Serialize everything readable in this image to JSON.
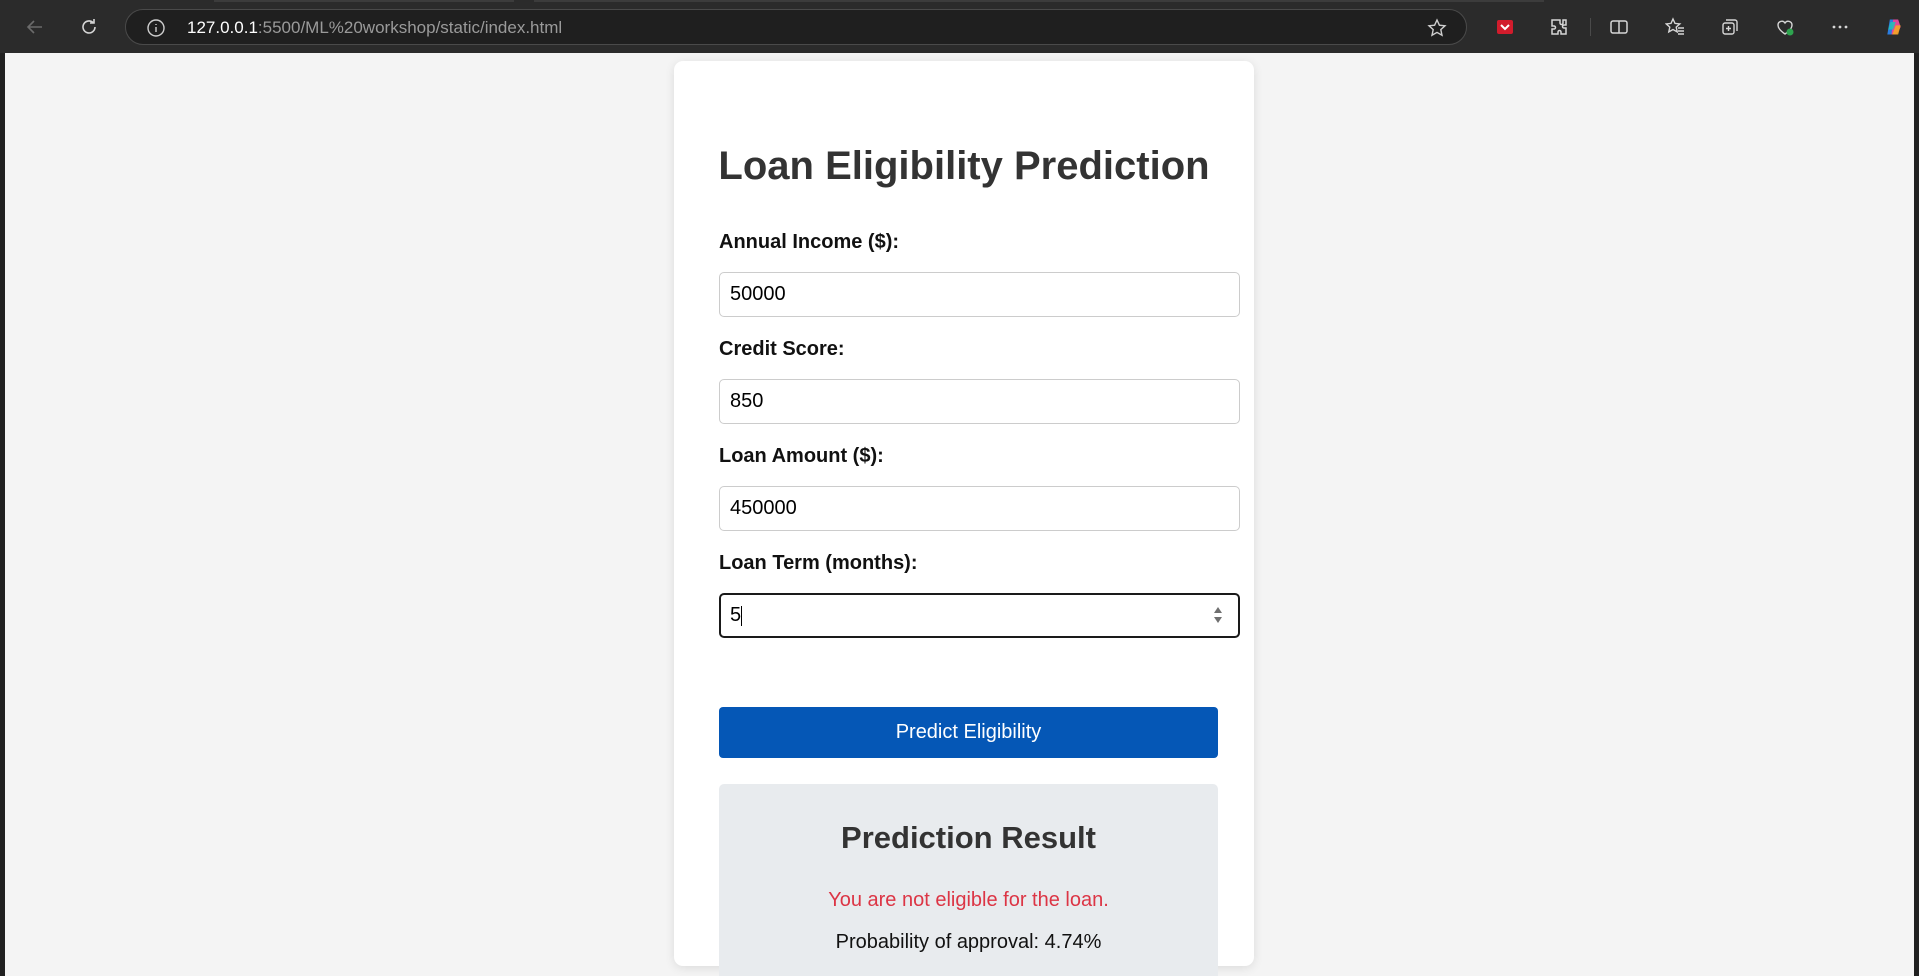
{
  "browser": {
    "url_host": "127.0.0.1",
    "url_path": ":5500/ML%20workshop/static/index.html",
    "icons": [
      "back-icon",
      "refresh-icon",
      "site-info-icon",
      "favorite-star-icon",
      "pocket-extension-icon",
      "extensions-icon",
      "split-screen-icon",
      "favorites-icon",
      "collections-icon",
      "browser-essentials-icon",
      "more-icon",
      "copilot-icon"
    ],
    "accent": "#0557b6"
  },
  "page": {
    "title": "Loan Eligibility Prediction",
    "fields": [
      {
        "label": "Annual Income ($):",
        "value": "50000"
      },
      {
        "label": "Credit Score:",
        "value": "850"
      },
      {
        "label": "Loan Amount ($):",
        "value": "450000"
      },
      {
        "label": "Loan Term (months):",
        "value": "5"
      }
    ],
    "submit_label": "Predict Eligibility",
    "result": {
      "heading": "Prediction Result",
      "verdict": "You are not eligible for the loan.",
      "probability_text": "Probability of approval: 4.74%",
      "verdict_color": "#dc3545"
    }
  }
}
